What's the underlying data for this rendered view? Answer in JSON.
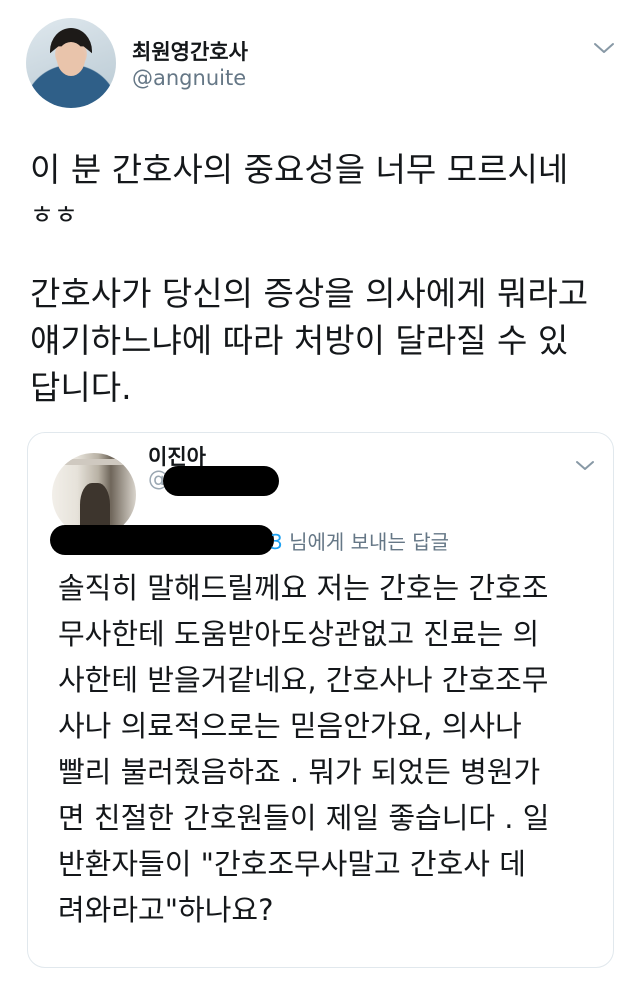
{
  "tweet": {
    "author_name": "최원영간호사",
    "author_handle": "@angnuite",
    "menu_icon": "chevron-down-icon",
    "paragraph_1_line_1": "이 분 간호사의 중요성을 너무 모르시네",
    "paragraph_1_line_2": "ㅎㅎ",
    "paragraph_2_line_1": "간호사가 당신의 증상을 의사에게 뭐라고",
    "paragraph_2_line_2": "얘기하느냐에 따라 처방이 달라질 수 있",
    "paragraph_2_line_3": "답니다."
  },
  "quoted_tweet": {
    "author_name": "이진아",
    "handle_visible": "@",
    "reply_mention_visible": "3",
    "reply_suffix": " 님에게 보내는 답글",
    "menu_icon": "chevron-down-icon",
    "body_lines": [
      "솔직히 말해드릴께요 저는 간호는 간호조",
      "무사한테 도움받아도상관없고 진료는 의",
      "사한테 받을거같네요, 간호사나 간호조무",
      "사나 의료적으로는 믿음안가요, 의사나",
      "빨리 불러줬음하죠 . 뭐가 되었든 병원가",
      "면 친절한 간호원들이 제일 좋습니다 . 일",
      "반환자들이 \"간호조무사말고 간호사 데",
      "려와라고\"하나요?"
    ]
  },
  "colors": {
    "text": "#14171a",
    "secondary": "#657786",
    "link": "#1da1f2",
    "border": "#e1e8ed"
  }
}
